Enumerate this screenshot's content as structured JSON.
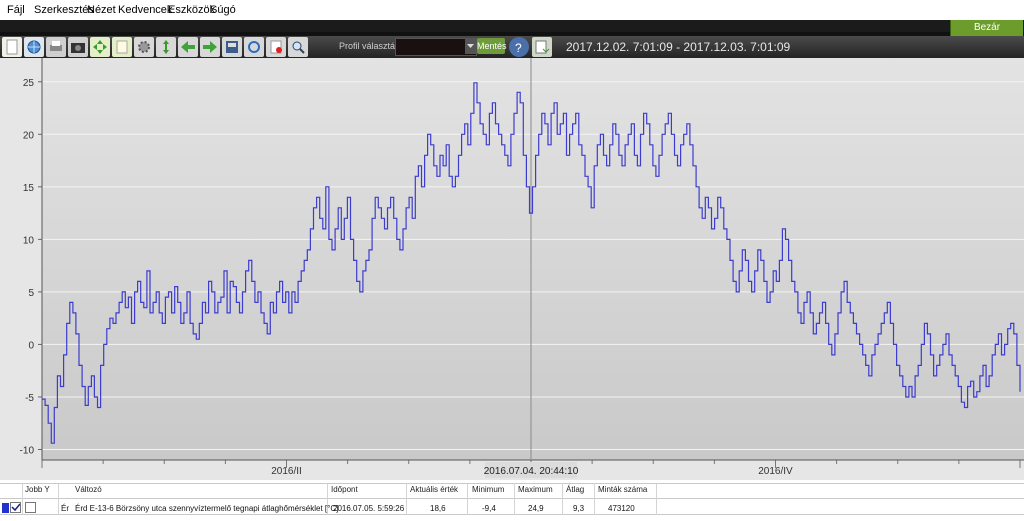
{
  "menu": [
    "Fájl",
    "Szerkesztés",
    "Nézet",
    "Kedvencek",
    "Eszközök",
    "Súgó"
  ],
  "window": {
    "close_label": "Bezár"
  },
  "toolbar": {
    "profile_label": "Profil választás",
    "profile_value": "",
    "save_label": "Mentés",
    "date_range": "2017.12.02. 7:01:09 - 2017.12.03. 7:01:09",
    "icons": [
      "new-icon",
      "globe-icon",
      "print-icon",
      "camera-icon",
      "fit-icon",
      "page-icon",
      "gear-icon",
      "vertical-fit-icon",
      "back-arrow-icon",
      "forward-arrow-icon",
      "export-icon",
      "refresh-icon",
      "delete-icon",
      "zoom-icon"
    ],
    "help_icon": "help-icon",
    "report_icon": "report-icon"
  },
  "chart_data": {
    "type": "line",
    "xlabels": [
      {
        "text": "2016/II",
        "pos": 0.25
      },
      {
        "text": "2016/IV",
        "pos": 0.75
      }
    ],
    "cursor_label": "2016.07.04. 20:44:10",
    "ylim": [
      -11,
      26.5
    ],
    "yticks": [
      -10,
      -5,
      0,
      5,
      10,
      15,
      20,
      25
    ],
    "grid": true,
    "color": "#3c3ccf",
    "series": [
      {
        "values": [
          -5.2,
          -5.8,
          -7.5,
          -9.4,
          -6,
          -3,
          -4,
          -1,
          2,
          4,
          3,
          1,
          -2,
          -4,
          -5.8,
          -4,
          -3,
          -5,
          -6,
          -2,
          0,
          1.5,
          2.5,
          2,
          3,
          4,
          5,
          3.5,
          4.5,
          2,
          5,
          6,
          4,
          3.5,
          7,
          3,
          4,
          5,
          3,
          2,
          4.5,
          5,
          3,
          5.5,
          4,
          2,
          3,
          5,
          2,
          1,
          0.5,
          2,
          4,
          3,
          6,
          5,
          3,
          4,
          4.5,
          7,
          3,
          6,
          5.5,
          4,
          3,
          5,
          7,
          8,
          6,
          4,
          5,
          3,
          2,
          1,
          4,
          3,
          5,
          6,
          4,
          5,
          3,
          5,
          4,
          6,
          7,
          8,
          9,
          11,
          13,
          14,
          12,
          11,
          15,
          10,
          9,
          11,
          13,
          10,
          12,
          14,
          10,
          8,
          6,
          5,
          7,
          8,
          9,
          12,
          14,
          13,
          12,
          11,
          13,
          14,
          12,
          10,
          9,
          11,
          13,
          14,
          12,
          16,
          17,
          15,
          18,
          20,
          19,
          17,
          16,
          18,
          17,
          19,
          16,
          15,
          16,
          18,
          20,
          21,
          19,
          22,
          24.9,
          23,
          21,
          20,
          19,
          22,
          23,
          21,
          20,
          19,
          18,
          17,
          20,
          22,
          24,
          23,
          18,
          15,
          12.5,
          15,
          18,
          20,
          22,
          21,
          19,
          22,
          23,
          20,
          21,
          22,
          18,
          20,
          21,
          22,
          19,
          18,
          16,
          15,
          13,
          17,
          19,
          20,
          18,
          17,
          19,
          21,
          20,
          18,
          17,
          19,
          20,
          21,
          18,
          17,
          20,
          22,
          21,
          19,
          17,
          16,
          18,
          20,
          21,
          22,
          20,
          18,
          17,
          19,
          20,
          21,
          19,
          17,
          15,
          13,
          12,
          14,
          13,
          11,
          12,
          14,
          13,
          11,
          10,
          8,
          6,
          5,
          7,
          9,
          8,
          6,
          5,
          7,
          9,
          8,
          6,
          4,
          5,
          7,
          6,
          8,
          11,
          10,
          8,
          6,
          5,
          3,
          2,
          4,
          5,
          3,
          1,
          2,
          3,
          4,
          2,
          0,
          -1,
          1,
          3,
          5,
          6,
          4,
          3,
          2,
          1,
          0,
          -1,
          -2,
          -3,
          -1,
          0,
          1,
          2,
          3,
          4,
          2,
          0,
          -2,
          -3,
          -4,
          -5,
          -4,
          -5,
          -3,
          -2,
          0,
          2,
          1,
          -1,
          -3,
          -2,
          -1,
          0,
          1,
          -1,
          -2,
          -3,
          -4,
          -5.5,
          -6,
          -4,
          -3.5,
          -5,
          -4.5,
          -3,
          -2,
          -4,
          -3,
          -1,
          0,
          1,
          -1,
          0,
          1.5,
          2,
          1,
          -2,
          -4.5
        ]
      }
    ]
  },
  "table": {
    "headers": [
      "Jobb Y",
      "Változó",
      "Időpont",
      "Aktuális érték",
      "Minimum",
      "Maximum",
      "Átlag",
      "Minták száma"
    ],
    "row": {
      "prefix": "Ér",
      "variable": "Érd E-13-6 Börzsöny utca szennyvíztermelő tegnapi átlaghőmérséklet [°C]",
      "timestamp": "2016.07.05. 5:59:26",
      "current": "18,6",
      "minimum": "-9,4",
      "maximum": "24,9",
      "average": "9,3",
      "samples": "473120"
    },
    "series_color": "#2233cc"
  }
}
